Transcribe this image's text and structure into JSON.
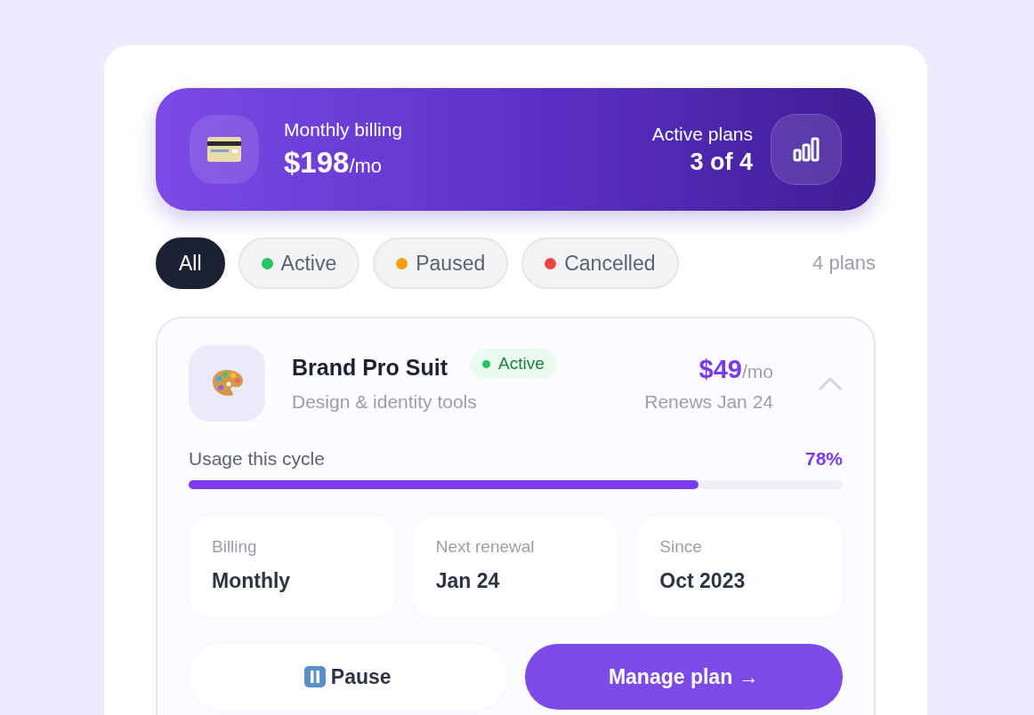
{
  "summary": {
    "label": "Monthly billing",
    "amount": "$198",
    "unit": "/mo",
    "active_label": "Active plans",
    "active_value": "3 of 4"
  },
  "filters": [
    {
      "label": "All",
      "selected": true
    },
    {
      "label": "Active",
      "selected": false,
      "color": "#22c55e"
    },
    {
      "label": "Paused",
      "selected": false,
      "color": "#f59e0b"
    },
    {
      "label": "Cancelled",
      "selected": false,
      "color": "#ef4444"
    }
  ],
  "plan_count": "4 plans",
  "plan": {
    "name": "Brand Pro Suit",
    "status": {
      "label": "Active",
      "color": "#22c55e"
    },
    "description": "Design & identity tools",
    "price": "$49",
    "unit": "/mo",
    "renews": "Renews Jan 24",
    "expanded": true,
    "usage": {
      "label": "Usage this cycle",
      "reading": "78%",
      "level": 0.78
    },
    "details": [
      {
        "label": "Billing",
        "value": "Monthly"
      },
      {
        "label": "Next renewal",
        "value": "Jan 24"
      },
      {
        "label": "Since",
        "value": "Oct 2023"
      }
    ],
    "actions": [
      {
        "kind": "secondary",
        "label": "Pause"
      },
      {
        "kind": "primary",
        "label": "Manage plan →"
      }
    ]
  }
}
